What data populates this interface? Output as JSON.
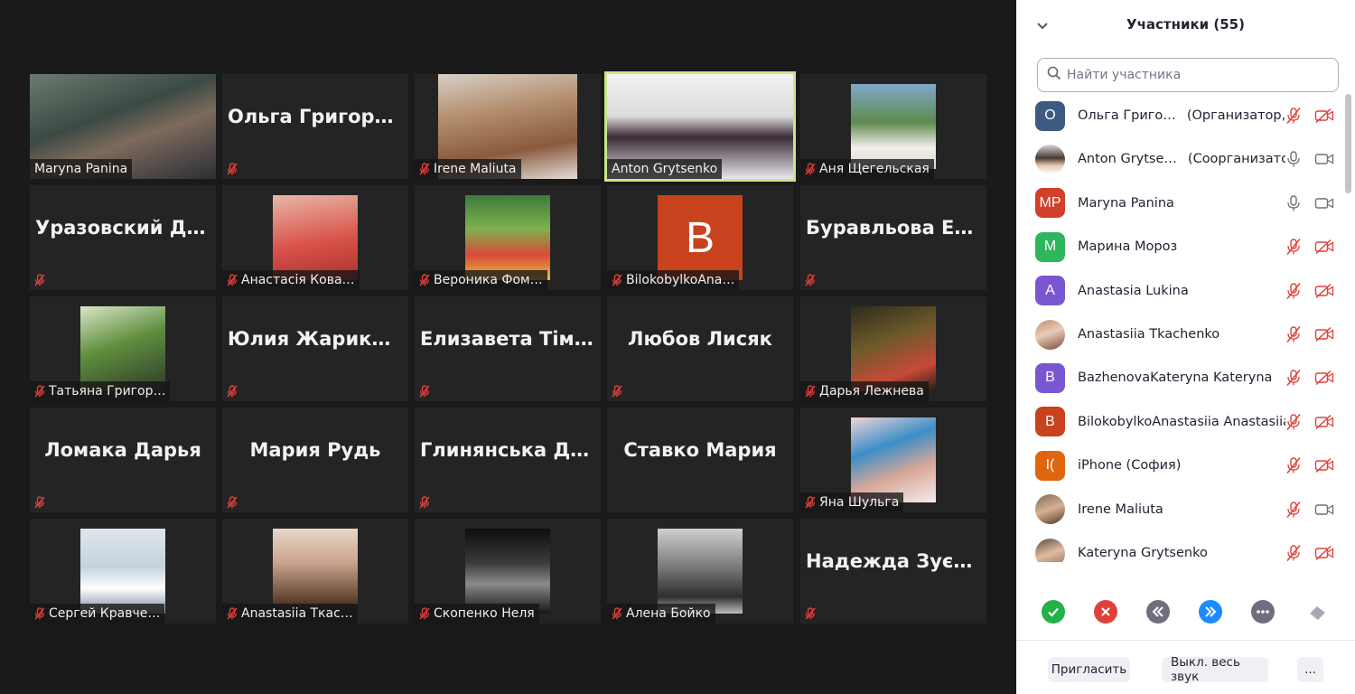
{
  "gallery": {
    "tiles": [
      {
        "label": "Maryna Panina",
        "muted": false
      },
      {
        "label": "",
        "bigname": "Ольга Григораш",
        "muted": true
      },
      {
        "label": "Irene Maliuta",
        "muted": true
      },
      {
        "label": "Anton Grytsenko",
        "muted": false,
        "active_speaker": true
      },
      {
        "label": "Аня Щегельская",
        "muted": true
      },
      {
        "label": "",
        "bigname": "Уразовский Да…",
        "muted": true
      },
      {
        "label": "Анастасія Кова…",
        "muted": true
      },
      {
        "label": "Вероника Фом…",
        "muted": true
      },
      {
        "label": "BilokobylkoAna…",
        "muted": true,
        "letter": "B"
      },
      {
        "label": "",
        "bigname": "Буравльова Ев…",
        "muted": true
      },
      {
        "label": "Татьяна Григор…",
        "muted": true
      },
      {
        "label": "",
        "bigname": "Юлия Жарикова",
        "muted": true
      },
      {
        "label": "",
        "bigname": "Елизавета Тімо…",
        "muted": true
      },
      {
        "label": "",
        "bigname": "Любов Лисяк",
        "muted": true
      },
      {
        "label": "Дарья Лежнева",
        "muted": true
      },
      {
        "label": "",
        "bigname": "Ломака Дарья",
        "muted": true
      },
      {
        "label": "",
        "bigname": "Мария Рудь",
        "muted": true
      },
      {
        "label": "",
        "bigname": "Глинянська Да…",
        "muted": true
      },
      {
        "label": "",
        "bigname": "Ставко Мария",
        "muted": false
      },
      {
        "label": "Яна Шульга",
        "muted": true
      },
      {
        "label": "Сергей Кравче…",
        "muted": true
      },
      {
        "label": "Anastasiia Ткас…",
        "muted": true
      },
      {
        "label": "Скопенко Неля",
        "muted": true
      },
      {
        "label": "Алена Бойко",
        "muted": true
      },
      {
        "label": "",
        "bigname": "Надежда Зуєнко",
        "muted": true
      }
    ]
  },
  "panel": {
    "title": "Участники (55)",
    "search_placeholder": "Найти участника",
    "participants": [
      {
        "avatar": "О",
        "avatar_color": "#3d5a80",
        "name": "Ольга Григо…",
        "role": "(Организатор, я)",
        "mic": "muted",
        "video": "off"
      },
      {
        "avatar": "",
        "avatar_color": "#8a9aa0",
        "name": "Anton Grytse…",
        "role": "(Соорганизатор)",
        "mic": "on",
        "video": "on"
      },
      {
        "avatar": "MP",
        "avatar_color": "#d23f2a",
        "name": "Maryna Panina",
        "role": "",
        "mic": "on",
        "video": "on"
      },
      {
        "avatar": "M",
        "avatar_color": "#2fb55e",
        "name": " Марина Мороз",
        "role": "",
        "mic": "muted",
        "video": "off"
      },
      {
        "avatar": "A",
        "avatar_color": "#7a57d1",
        "name": "Anastasia Lukina",
        "role": "",
        "mic": "muted",
        "video": "off"
      },
      {
        "avatar": "",
        "avatar_color": "#c9a88e",
        "name": "Anastasiia Tkachenko",
        "role": "",
        "mic": "muted",
        "video": "off"
      },
      {
        "avatar": "B",
        "avatar_color": "#7a57d1",
        "name": "BazhenovaKateryna Kateryna",
        "role": "",
        "mic": "muted",
        "video": "off"
      },
      {
        "avatar": "B",
        "avatar_color": "#c8421e",
        "name": "BilokobylkoAnastasiia Anastasiia",
        "role": "",
        "mic": "muted",
        "video": "off"
      },
      {
        "avatar": "I(",
        "avatar_color": "#e0650f",
        "name": "iPhone (София)",
        "role": "",
        "mic": "muted",
        "video": "off"
      },
      {
        "avatar": "",
        "avatar_color": "#b48a6a",
        "name": "Irene Maliuta",
        "role": "",
        "mic": "muted",
        "video": "on"
      },
      {
        "avatar": "",
        "avatar_color": "#9c7f6b",
        "name": "Kateryna Grytsenko",
        "role": "",
        "mic": "muted",
        "video": "off"
      }
    ],
    "reactions": [
      "yes-icon",
      "no-icon",
      "slower-icon",
      "faster-icon",
      "more-icon",
      "clear-icon"
    ],
    "invite_label": "Пригласить",
    "mute_all_label": "Выкл. весь звук",
    "more_label": "..."
  }
}
